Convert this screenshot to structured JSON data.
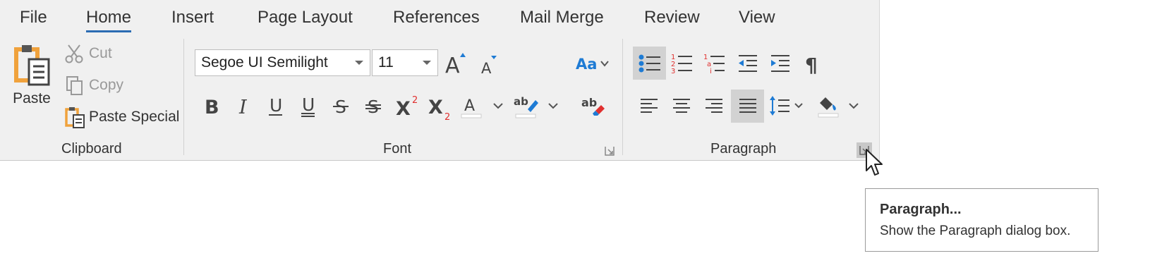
{
  "tabs": [
    {
      "label": "File"
    },
    {
      "label": "Home",
      "active": true
    },
    {
      "label": "Insert"
    },
    {
      "label": "Page Layout"
    },
    {
      "label": "References"
    },
    {
      "label": "Mail Merge"
    },
    {
      "label": "Review"
    },
    {
      "label": "View"
    }
  ],
  "clipboard": {
    "paste_label": "Paste",
    "cut_label": "Cut",
    "copy_label": "Copy",
    "paste_special_label": "Paste Special",
    "group_label": "Clipboard"
  },
  "font": {
    "font_name": "Segoe UI Semilight",
    "font_size": "11",
    "group_label": "Font"
  },
  "paragraph": {
    "group_label": "Paragraph"
  },
  "tooltip": {
    "title": "Paragraph...",
    "description": "Show the Paragraph dialog box."
  },
  "colors": {
    "accent": "#2b6cb3",
    "ribbon_bg": "#f0f0f0",
    "selected_bg": "#d2d2d2",
    "icon_red": "#e0302f",
    "icon_blue": "#1e7bd4",
    "icon_orange": "#f0a23c"
  }
}
